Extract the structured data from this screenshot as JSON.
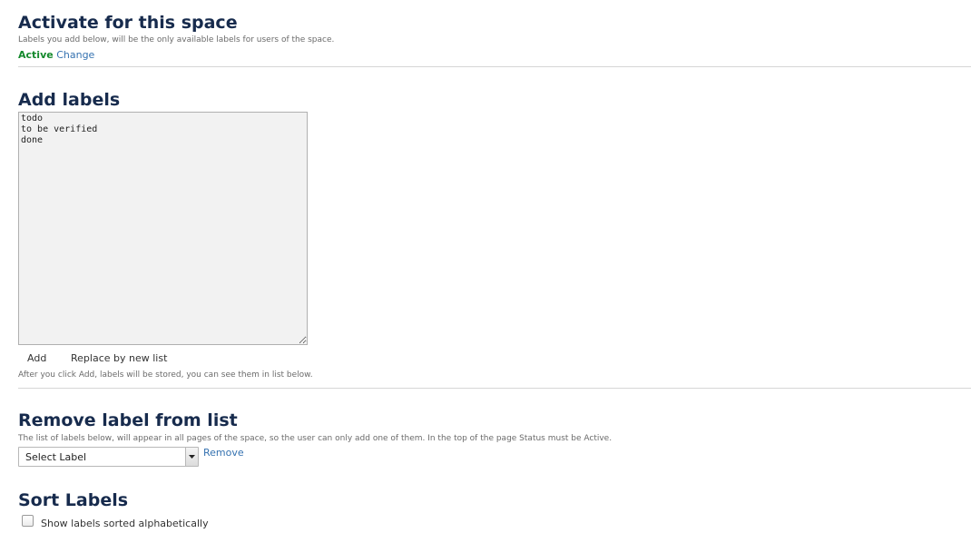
{
  "activate": {
    "title": "Activate for this space",
    "description": "Labels you add below, will be the only available labels for users of the space.",
    "status": "Active",
    "change_link": "Change"
  },
  "add_labels": {
    "title": "Add labels",
    "textarea_value": "todo\nto be verified\ndone",
    "add_button": "Add",
    "replace_button": "Replace by new list",
    "hint": "After you click Add, labels will be stored, you can see them in list below."
  },
  "remove_label": {
    "title": "Remove label from list",
    "description": "The list of labels below, will appear in all pages of the space, so the user can only add one of them. In the top of the page Status must be Active.",
    "select_value": "Select Label",
    "remove_link": "Remove"
  },
  "sort_labels": {
    "title": "Sort Labels",
    "checkbox_label": "Show labels sorted alphabetically",
    "checked": false
  },
  "colors": {
    "heading": "#172b4d",
    "active_status": "#14892c",
    "link": "#3572b0",
    "divider": "#d6d6d6"
  }
}
